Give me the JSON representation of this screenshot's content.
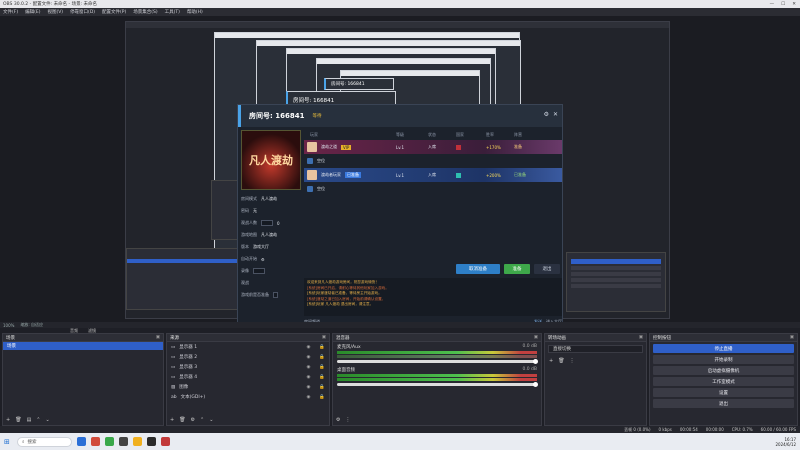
{
  "window": {
    "title": "OBS 30.0.2 - 配置文件: 未命名 - 场景: 未命名",
    "controls": [
      "—",
      "☐",
      "✕"
    ]
  },
  "menu": [
    "文件(F)",
    "编辑(E)",
    "视图(V)",
    "停靠窗口(D)",
    "配置文件(P)",
    "场景集合(S)",
    "工具(T)",
    "帮助(H)"
  ],
  "tunnel_labels": [
    "房间号: 166841",
    "房间号: 166841"
  ],
  "room": {
    "title": "房间号: 166841",
    "tag": "等待",
    "poster_text": "凡人渡劫",
    "header": {
      "player": "玩家",
      "level": "等级",
      "status": "状态",
      "team": "国家",
      "rate": "胜率",
      "flag": "阵营"
    },
    "left_rows": [
      {
        "label": "房间模式",
        "value": "凡人渡劫"
      },
      {
        "label": "密码",
        "value": "无"
      },
      {
        "label": "观战人数",
        "value": "0"
      },
      {
        "label": "游戏地图",
        "value": "凡人渡劫"
      },
      {
        "label": "版本",
        "value": "游戏大厅"
      },
      {
        "label": "自动开始",
        "value": "⚙"
      },
      {
        "label": "录像",
        "value": ""
      },
      {
        "label": "观战",
        "value": ""
      },
      {
        "label": "游戏前是否准备",
        "value": ""
      }
    ],
    "players": [
      {
        "name": "渡劫之道",
        "badge": "VIP",
        "level": "Lv.1",
        "status": "入席",
        "flag_color": "#c0303a",
        "rate": "+170%",
        "side": "准备"
      },
      {
        "name": "空位",
        "empty": true
      },
      {
        "name": "渡劫者玩家",
        "badge": "已准备",
        "level": "Lv.1",
        "status": "入席",
        "flag_color": "#2ec0b0",
        "rate": "+200%",
        "side": "已准备"
      },
      {
        "name": "空位",
        "empty": true
      }
    ],
    "buttons": {
      "cancel_ready": "取消准备",
      "ready": "准备",
      "exit": "退出"
    },
    "chat": [
      "欢迎来到凡人渡劫游戏房间，祝您游戏愉快！",
      "[系统]房间已开启，请耐心等待其他玩家加入游戏。",
      "[系统]玩家渡劫者已准备，等待房主开始游戏。",
      "[系统]渡劫之道已加入房间，开始前请确认设置。",
      "[系统]玩家 凡人渡劫 退出房间，请注意。"
    ],
    "chat_input": {
      "channel": "房间频道",
      "send": "发送",
      "more": "进入大厅"
    }
  },
  "statusstrip": {
    "left": "100%",
    "right": "缩放: 自适应"
  },
  "docks": {
    "scenes": {
      "title": "场景",
      "items": [
        "场景"
      ]
    },
    "sources": {
      "title": "来源",
      "items": [
        "显示器 1",
        "显示器 2",
        "显示器 3",
        "显示器 4",
        "图像",
        "文本(GDI+)"
      ]
    },
    "mixer": {
      "title": "混音器",
      "channels": [
        {
          "name": "麦克风/Aux",
          "db": "0.0 dB"
        },
        {
          "name": "桌面音频",
          "db": "0.0 dB"
        }
      ]
    },
    "transitions": {
      "title": "转场动画",
      "value": "直接切换"
    },
    "controls": {
      "title": "控制按钮",
      "buttons": [
        "停止直播",
        "开始录制",
        "启动虚拟摄像机",
        "工作室模式",
        "设置",
        "退出"
      ]
    }
  },
  "filters_tabs": {
    "audio": "音频",
    "filters": "滤镜"
  },
  "obs_status": {
    "dropped": "丢帧 0 (0.0%)",
    "live": "00:00:54",
    "rec": "00:00:00",
    "cpu": "CPU: 0.7%",
    "fps": "60.00 / 60.00 FPS",
    "kbps": "0 kbps"
  },
  "taskbar": {
    "search": "搜索",
    "time": "16:17",
    "date": "2024/6/12",
    "apps": [
      "#2b6fd6",
      "#d14b3b",
      "#3aa84a",
      "#444444",
      "#f0b020",
      "#2b2b2b",
      "#c23a3a"
    ]
  }
}
